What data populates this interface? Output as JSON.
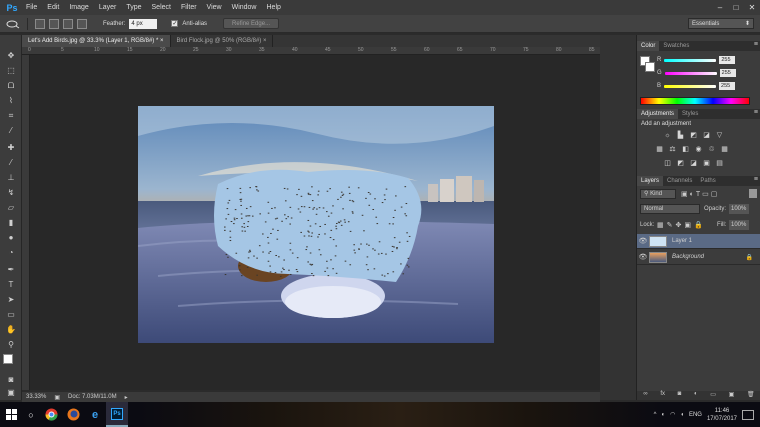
{
  "app": {
    "logo": "Ps"
  },
  "menu": [
    "File",
    "Edit",
    "Image",
    "Layer",
    "Type",
    "Select",
    "Filter",
    "View",
    "Window",
    "Help"
  ],
  "window_controls": [
    "–",
    "□",
    "✕"
  ],
  "options": {
    "feather_label": "Feather:",
    "feather_value": "4 px",
    "antialias_label": "Anti-alias",
    "refine_label": "Refine Edge...",
    "workspace": "Essentials"
  },
  "tabs": [
    {
      "label": "Let's Add Birds.jpg @ 33.3% (Layer 1, RGB/8#) *",
      "close": "×"
    },
    {
      "label": "Bird Flock.jpg @ 50% (RGB/8#)",
      "close": "×"
    }
  ],
  "ruler_top": [
    "0",
    "5",
    "10",
    "15",
    "20",
    "25",
    "30",
    "35",
    "40",
    "45",
    "50",
    "55",
    "60",
    "65",
    "70",
    "75",
    "80",
    "85"
  ],
  "status": {
    "zoom": "33.33%",
    "doc": "Doc: 7.03M/11.0M"
  },
  "color_panel": {
    "tabs": [
      "Color",
      "Swatches"
    ],
    "r_label": "R",
    "g_label": "G",
    "b_label": "B",
    "r": "255",
    "g": "255",
    "b": "255",
    "foreground": "#ffffff",
    "background": "#ffffff"
  },
  "adjustments": {
    "tabs": [
      "Adjustments",
      "Styles"
    ],
    "title": "Add an adjustment"
  },
  "layers_panel": {
    "tabs": [
      "Layers",
      "Channels",
      "Paths"
    ],
    "filter": "Kind",
    "blend": "Normal",
    "opacity_label": "Opacity:",
    "opacity": "100%",
    "lock_label": "Lock:",
    "fill_label": "Fill:",
    "fill": "100%",
    "layers": [
      {
        "name": "Layer 1",
        "selected": true
      },
      {
        "name": "Background",
        "selected": false,
        "locked": true
      }
    ]
  },
  "taskbar": {
    "language": "ENG",
    "time": "11:46",
    "date": "17/07/2017"
  }
}
